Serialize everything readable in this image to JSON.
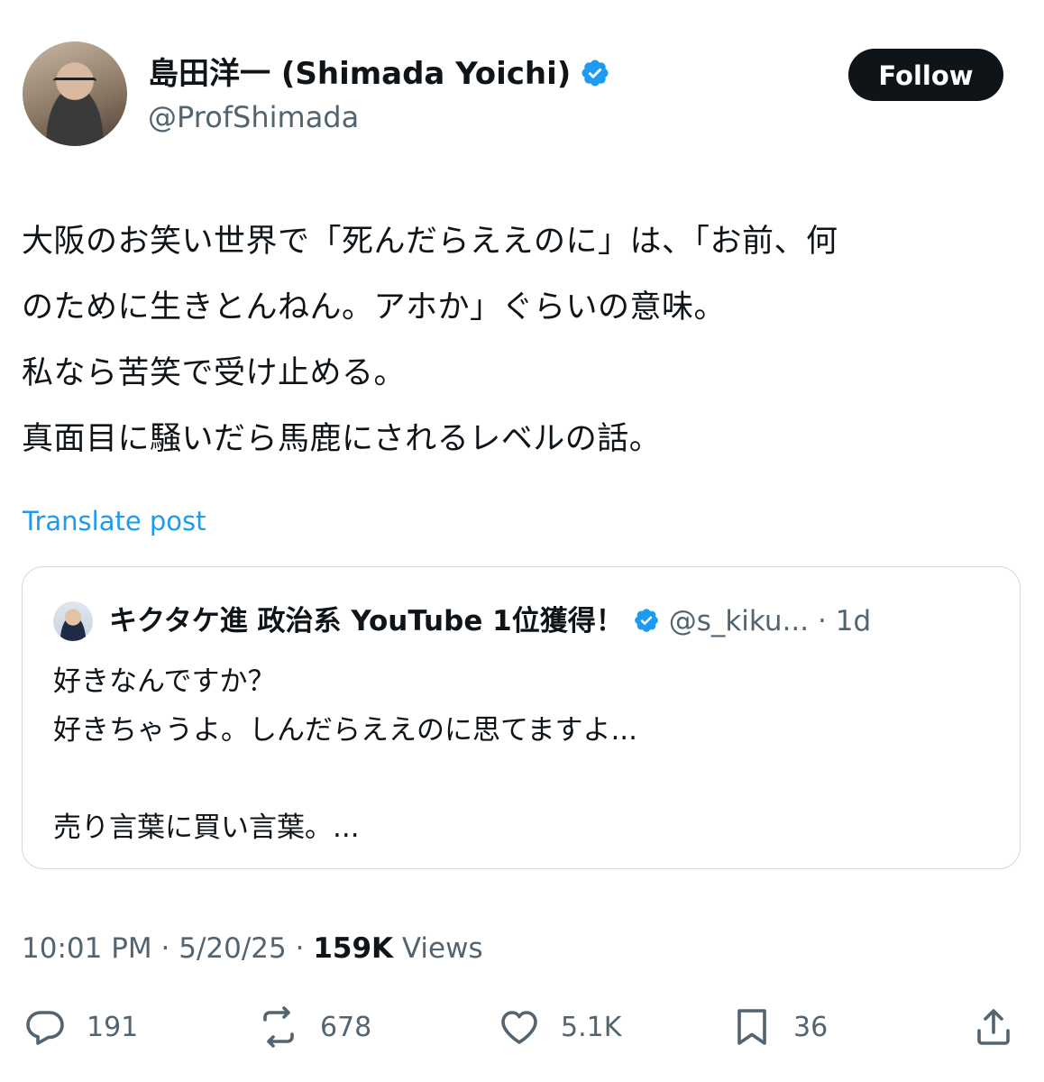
{
  "author": {
    "display_name": "島田洋一 (Shimada Yoichi)",
    "handle": "@ProfShimada",
    "verified": true
  },
  "follow_label": "Follow",
  "post": {
    "text": "大阪のお笑い世界で「死んだらええのに」は、「お前、何\nのために生きとんねん。アホか」ぐらいの意味。\n私なら苦笑で受け止める。\n真面目に騒いだら馬鹿にされるレベルの話。",
    "translate_label": "Translate post"
  },
  "quoted": {
    "display_name": "キクタケ進 政治系 YouTube 1位獲得！",
    "handle": "@s_kiku...",
    "separator": "·",
    "time": "1d",
    "text": "好きなんですか？\n好きちゃうよ。しんだらええのに思てますよ...\n\n売り言葉に買い言葉。..."
  },
  "meta": {
    "time": "10:01 PM",
    "date": "5/20/25",
    "separator": "·",
    "views_count": "159K",
    "views_label": "Views"
  },
  "actions": {
    "replies": "191",
    "reposts": "678",
    "likes": "5.1K",
    "bookmarks": "36"
  },
  "colors": {
    "accent": "#1d9bf0",
    "text": "#0f1419",
    "muted": "#536471",
    "border": "#cfd9de"
  }
}
